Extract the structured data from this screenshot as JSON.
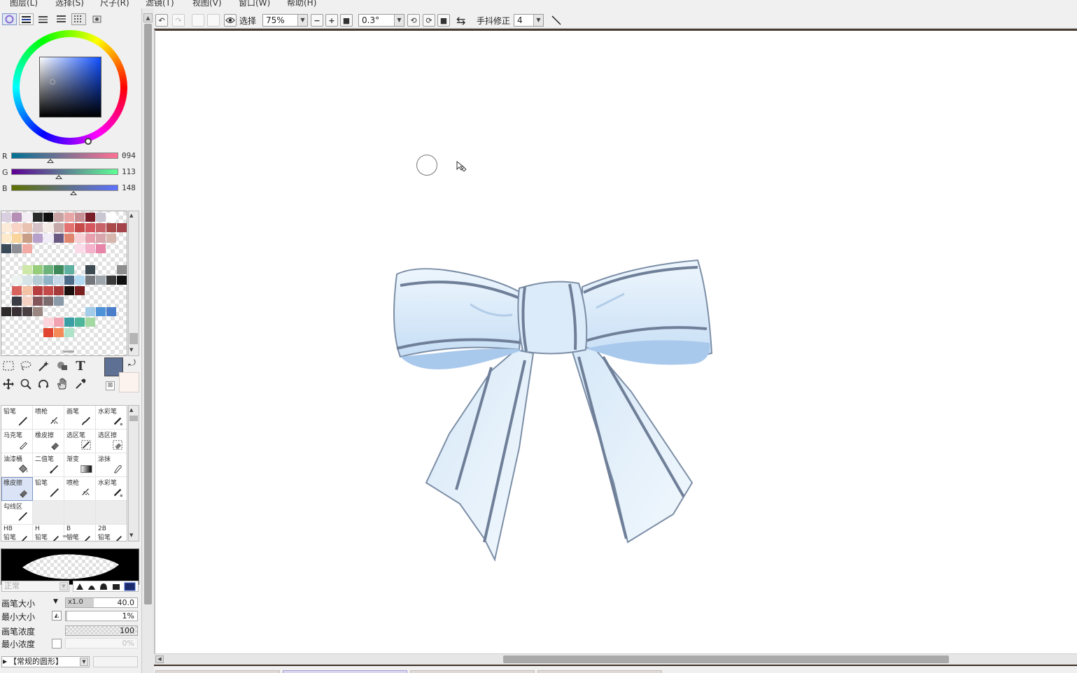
{
  "menu": [
    "图层(L)",
    "选择(S)",
    "尺子(R)",
    "滤镜(T)",
    "视图(V)",
    "窗口(W)",
    "帮助(H)"
  ],
  "toolbar": {
    "select_label": "选择",
    "zoom": "75%",
    "rotation": "0.3°",
    "stabilizer_label": "手抖修正",
    "stabilizer_value": "4"
  },
  "color": {
    "current_hex": "#5e7194",
    "secondary_hex": "#fdf3ee",
    "r_label": "R",
    "g_label": "G",
    "b_label": "B",
    "r": "094",
    "g": "113",
    "b": "148",
    "r_fraction": 0.369,
    "g_fraction": 0.443,
    "b_fraction": 0.58
  },
  "swatches": [
    [
      "#d9cfe0",
      "#b58fb5",
      "#f2eef4",
      "#2a2a2a",
      "#101010",
      "#c8a2a2",
      "#e8a7a7",
      "#c89094",
      "#7a1e2a",
      "#c9c7d2",
      "#ffffff",
      ""
    ],
    [
      "#fcebd9",
      "#f8d3c6",
      "#e9c2b2",
      "#d6c3c9",
      "#f5ece8",
      "#c5a8a8",
      "#e3716f",
      "#c74a4a",
      "#d5565e",
      "#c86469",
      "#aa4a4a",
      "#a6444b"
    ],
    [
      "#fdeacb",
      "#f9d59b",
      "#c89e86",
      "#b8a0cc",
      "#f0ecf8",
      "#6a5a82",
      "#e0856e",
      "#f8d0d6",
      "#e9a0ae",
      "#d9a6ad",
      "#d7b6ad",
      ""
    ],
    [
      "#3a4958",
      "#8d8f94",
      "#f2aaa4",
      "",
      "",
      "",
      "",
      "#fadbe7",
      "#f3b2ca",
      "#e884a8",
      "",
      ""
    ],
    [
      "",
      "",
      "",
      "",
      "",
      "",
      "",
      "",
      "",
      "",
      "",
      ""
    ],
    [
      "",
      "",
      "#cde8a9",
      "#95cd7a",
      "#6cb47c",
      "#3f8a5a",
      "#5eb0a0",
      "",
      "#3e4a52",
      "",
      "",
      "#8e8e8e"
    ],
    [
      "",
      "#edf3ee",
      "#d6e3e7",
      "#b5ccd5",
      "#8fb3c7",
      "#c5d8e8",
      "#4c6b88",
      "#b2daf3",
      "#74787c",
      "#9ea6ac",
      "#3a3a3a",
      "#101010"
    ],
    [
      "",
      "#d8635d",
      "#f4c2a4",
      "#b83f3f",
      "#c34a48",
      "#a63a3a",
      "#1a1010",
      "#7a2020",
      "",
      "",
      "",
      ""
    ],
    [
      "",
      "#3b3b45",
      "#f4d1c2",
      "#84565a",
      "#7b6a6e",
      "#8a9aa8",
      "",
      "",
      "",
      "",
      "",
      ""
    ],
    [
      "#2e2a2c",
      "#383034",
      "#4a4044",
      "#9a8680",
      "",
      "",
      "",
      "",
      "#a4cbe8",
      "#4e92d8",
      "#4a7ecb",
      ""
    ],
    [
      "",
      "",
      "",
      "",
      "#fdd5dc",
      "#f1a3b2",
      "#3a9ea5",
      "#4cb59a",
      "#a4d9a4",
      "",
      "",
      ""
    ],
    [
      "",
      "",
      "",
      "",
      "#e0432f",
      "#f48a58",
      "#aee3c8",
      "",
      "",
      "",
      "",
      ""
    ]
  ],
  "brushes": [
    {
      "name": "铅笔",
      "icon": "pencil"
    },
    {
      "name": "喷枪",
      "icon": "airbrush"
    },
    {
      "name": "画笔",
      "icon": "brush"
    },
    {
      "name": "水彩笔",
      "icon": "watercolor"
    },
    {
      "name": "马克笔",
      "icon": "marker"
    },
    {
      "name": "橡皮擦",
      "icon": "eraser"
    },
    {
      "name": "选区笔",
      "icon": "selpen"
    },
    {
      "name": "选区擦",
      "icon": "selerase"
    },
    {
      "name": "油漆桶",
      "icon": "bucket"
    },
    {
      "name": "二值笔",
      "icon": "binary"
    },
    {
      "name": "渐变",
      "icon": "gradient"
    },
    {
      "name": "涂抹",
      "icon": "smudge"
    },
    {
      "name": "橡皮擦",
      "icon": "eraser",
      "active": true
    },
    {
      "name": "铅笔",
      "icon": "pencil"
    },
    {
      "name": "喷枪",
      "icon": "airbrush"
    },
    {
      "name": "水彩笔",
      "icon": "watercolor"
    },
    {
      "name": "勾线区",
      "icon": "pencil"
    },
    {
      "name": "",
      "icon": ""
    },
    {
      "name": "",
      "icon": ""
    },
    {
      "name": "",
      "icon": ""
    },
    {
      "name": "HB",
      "name2": "铅笔",
      "icon": "pencil"
    },
    {
      "name": "H",
      "name2": "铅笔",
      "icon": "pencil"
    },
    {
      "name": "B",
      "name2": "铅笔",
      "icon": "pencil"
    },
    {
      "name": "2B",
      "name2": "铅笔",
      "icon": "pencil"
    }
  ],
  "brush_settings": {
    "blend_mode": "正常",
    "size_label": "画笔大小",
    "size_multiplier": "x1.0",
    "size_value": "40.0",
    "min_size_label": "最小大小",
    "min_size_value": "1%",
    "density_label": "画笔浓度",
    "density_value": "100",
    "min_density_label": "最小浓度",
    "min_density_value": "0%",
    "brush_shape": "【常规的圆形】"
  },
  "icons": {
    "eye": "eye-icon",
    "pointer": "cursor-icon",
    "brush_cursor": "brush-circle-cursor-icon"
  }
}
